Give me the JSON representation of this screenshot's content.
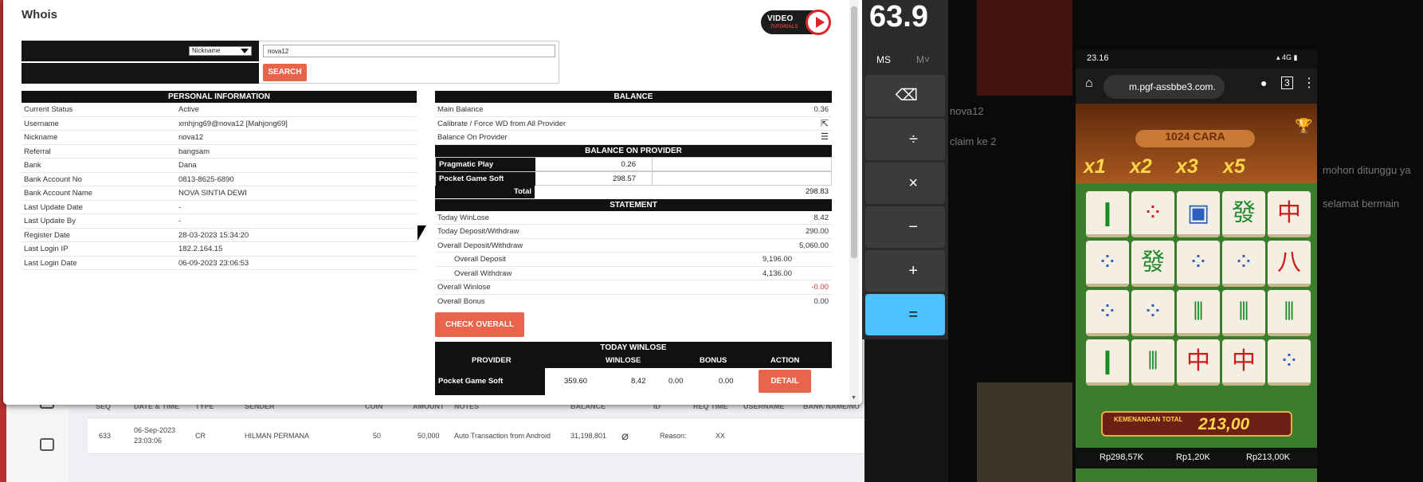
{
  "dialog": {
    "title": "Whois",
    "video_badge_line1": "VIDEO",
    "video_badge_line2": "TUTORIALS",
    "search": {
      "select_value": "Nickname",
      "input_value": "nova12",
      "button": "SEARCH"
    },
    "personal": {
      "header": "PERSONAL INFORMATION",
      "rows": [
        {
          "k": "Current Status",
          "v": "Active"
        },
        {
          "k": "Username",
          "v": "xmhjng69@nova12  [Mahjong69]"
        },
        {
          "k": "Nickname",
          "v": "nova12"
        },
        {
          "k": "Referral",
          "v": "bangsam"
        },
        {
          "k": "Bank",
          "v": "Dana"
        },
        {
          "k": "Bank Account No",
          "v": "0813-8625-6890"
        },
        {
          "k": "Bank Account Name",
          "v": "NOVA SINTIA DEWI"
        },
        {
          "k": "Last Update Date",
          "v": "-"
        },
        {
          "k": "Last Update By",
          "v": "-"
        },
        {
          "k": "Register Date",
          "v": "28-03-2023 15:34:20"
        },
        {
          "k": "Last Login IP",
          "v": "182.2.164.15"
        },
        {
          "k": "Last Login Date",
          "v": "06-09-2023 23:06:53"
        }
      ]
    },
    "balance": {
      "header": "BALANCE",
      "main_balance_label": "Main Balance",
      "main_balance": "0.36",
      "calibrate_label": "Calibrate / Force WD from All Provider",
      "on_provider_label": "Balance On Provider",
      "on_provider_header": "BALANCE ON PROVIDER",
      "providers": [
        {
          "name": "Pragmatic Play",
          "amount": "0.26"
        },
        {
          "name": "Pocket Game Soft",
          "amount": "298.57"
        }
      ],
      "total_label": "Total",
      "total": "298.83"
    },
    "statement": {
      "header": "STATEMENT",
      "today_winlose_label": "Today WinLose",
      "today_winlose": "8.42",
      "today_dw_label": "Today Deposit/Withdraw",
      "today_dw": "290.00",
      "overall_dw_label": "Overall Deposit/Withdraw",
      "overall_dw": "5,060.00",
      "overall_deposit_label": "Overall Deposit",
      "overall_deposit": "9,196.00",
      "overall_withdraw_label": "Overall Withdraw",
      "overall_withdraw": "4,136.00",
      "overall_winlose_label": "Overall Winlose",
      "overall_winlose": "-0.00",
      "overall_bonus_label": "Overall Bonus",
      "overall_bonus": "0.00",
      "check_button": "CHECK OVERALL"
    },
    "today_winlose": {
      "header": "TODAY WINLOSE",
      "columns": [
        "PROVIDER",
        "WINLOSE",
        "BONUS",
        "ACTION"
      ],
      "row": {
        "provider": "Pocket Game Soft",
        "c1": "359.60",
        "winlose": "8.42",
        "c3": "0.00",
        "bonus": "0.00",
        "action": "DETAIL"
      }
    }
  },
  "background_table": {
    "headers": [
      "SEQ",
      "DATE & TIME",
      "TYPE",
      "SENDER",
      "COIN",
      "AMOUNT",
      "NOTES",
      "BALANCE",
      "ID",
      "REQ TIME",
      "USERNAME",
      "BANK NAME/NO"
    ],
    "row": {
      "seq": "633",
      "date": "06-Sep-2023",
      "time": "23:03:06",
      "type": "CR",
      "sender": "HILMAN PERMANA",
      "coin": "50",
      "amount": "50,000",
      "notes": "Auto Transaction from Android",
      "balance": "31,198,801",
      "reason": "Reason:",
      "req": "XX"
    }
  },
  "calculator": {
    "display": "63.9",
    "ms": "MS",
    "mv": "M˅",
    "keys": [
      "⌫",
      "÷",
      "×",
      "−",
      "+",
      "="
    ]
  },
  "chat_bg": [
    "nova12",
    "claim ke 2",
    "mohon ditunggu ya",
    "selamat bermain"
  ],
  "phone": {
    "time": "23.16",
    "url": "m.pgf-assbbe3.com.",
    "cara": "1024 CARA",
    "multipliers": [
      "x1",
      "x2",
      "x3",
      "x5"
    ],
    "win_label": "KEMENANGAN TOTAL",
    "win_value": "213,00",
    "balance": "Rp298,57K",
    "bet": "Rp1,20K",
    "last_win": "Rp213,00K"
  }
}
